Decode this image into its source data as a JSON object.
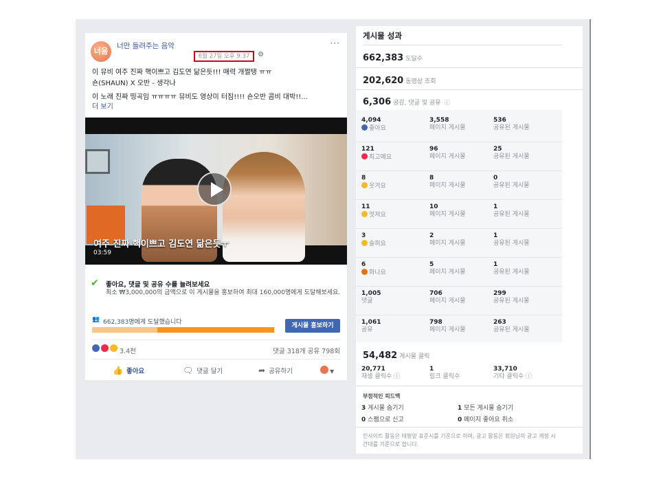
{
  "post": {
    "avatar_text": "너음",
    "page_name": "너만 들려주는 음악",
    "timestamp": "6월 27일 오후 9:37",
    "more": "···",
    "text_lines": [
      "이 뮤비 여주 진짜 핵이쁘고 김도연 닮은듯!!! 매력 개쩔탱 ㅠㅠ",
      "숀(SHAUN) X 오반 - 생각나",
      "이 노래 진짜 띵곡임 ㅠㅠㅠㅠ 뮤비도 영상미 터짐!!!! 숀오반 콤비 대박!!..."
    ],
    "see_more": "더 보기",
    "video": {
      "title": "여주 진짜 핵이쁘고 김도연 닮은듯ㅜ",
      "duration": "03:59"
    },
    "boost": {
      "title": "좋아요, 댓글 및 공유 수를 늘려보세요",
      "desc": "최소 ₩3,000,000의 금액으로 이 게시물을 홍보하여 최대 160,000명에게 도달해보세요.",
      "reach_count": "662,383명",
      "reach_suffix": "에게 도달했습니다",
      "reach_fraction": 0.36,
      "button": "게시물 홍보하기"
    },
    "reactions_count": "3.4천",
    "comments_shares": "댓글 318개  공유 798회",
    "actions": {
      "like": "좋아요",
      "comment": "댓글 달기",
      "share": "공유하기"
    }
  },
  "insights": {
    "title": "게시물 성과",
    "reach": {
      "value": "662,383",
      "label": "도달수"
    },
    "video_views": {
      "value": "202,620",
      "label": "동영상 조회"
    },
    "engagement": {
      "value": "6,306",
      "label": "공감, 댓글 및 공유"
    },
    "rows": [
      {
        "total": "4,094",
        "label": "좋아요",
        "page": "3,558",
        "page_label": "페이지 게시물",
        "shared": "536",
        "shared_label": "공유된 게시물",
        "emo_color": "#4267b2"
      },
      {
        "total": "121",
        "label": "최고예요",
        "page": "96",
        "page_label": "페이지 게시물",
        "shared": "25",
        "shared_label": "공유된 게시물",
        "emo_color": "#f0284a"
      },
      {
        "total": "8",
        "label": "웃겨요",
        "page": "8",
        "page_label": "페이지 게시물",
        "shared": "0",
        "shared_label": "공유된 게시물",
        "emo_color": "#f7b928"
      },
      {
        "total": "11",
        "label": "멋져요",
        "page": "10",
        "page_label": "페이지 게시물",
        "shared": "1",
        "shared_label": "공유된 게시물",
        "emo_color": "#f7b928"
      },
      {
        "total": "3",
        "label": "슬퍼요",
        "page": "2",
        "page_label": "페이지 게시물",
        "shared": "1",
        "shared_label": "공유된 게시물",
        "emo_color": "#f7b928"
      },
      {
        "total": "6",
        "label": "화나요",
        "page": "5",
        "page_label": "페이지 게시물",
        "shared": "1",
        "shared_label": "공유된 게시물",
        "emo_color": "#e9710f"
      },
      {
        "total": "1,005",
        "label": "댓글",
        "page": "706",
        "page_label": "페이지 게시물",
        "shared": "299",
        "shared_label": "공유된 게시물"
      },
      {
        "total": "1,061",
        "label": "공유",
        "page": "798",
        "page_label": "페이지 게시물",
        "shared": "263",
        "shared_label": "공유된 게시물"
      }
    ],
    "clicks": {
      "value": "54,482",
      "label": "게시물 클릭"
    },
    "click_breakdown": [
      {
        "value": "20,771",
        "label": "재생 클릭수"
      },
      {
        "value": "1",
        "label": "링크 클릭수"
      },
      {
        "value": "33,710",
        "label": "기타 클릭수"
      }
    ],
    "negative": {
      "title": "부정적인 피드백",
      "hide_post_count": "3",
      "hide_post_label": "게시물 숨기기",
      "hide_all_count": "1",
      "hide_all_label": "모든 게시물 숨기기",
      "spam_count": "0",
      "spam_label": "스팸으로 신고",
      "unlike_count": "0",
      "unlike_label": "페이지 좋아요 취소"
    },
    "footer": "인사이트 활동은 태평양 표준시를 기준으로 하며, 광고 활동은 회원님의 광고 계정 시간대를 기준으로 합니다."
  }
}
